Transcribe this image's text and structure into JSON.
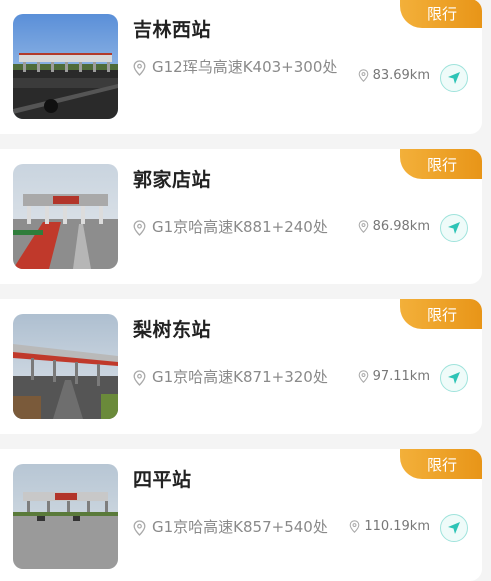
{
  "stations": [
    {
      "name": "吉林西站",
      "address": "G12珲乌高速K403+300处",
      "distance": "83.69km",
      "badge": "限行",
      "photo_icon": "toll-station-photo"
    },
    {
      "name": "郭家店站",
      "address": "G1京哈高速K881+240处",
      "distance": "86.98km",
      "badge": "限行",
      "photo_icon": "toll-station-photo"
    },
    {
      "name": "梨树东站",
      "address": "G1京哈高速K871+320处",
      "distance": "97.11km",
      "badge": "限行",
      "photo_icon": "toll-station-photo"
    },
    {
      "name": "四平站",
      "address": "G1京哈高速K857+540处",
      "distance": "110.19km",
      "badge": "限行",
      "photo_icon": "toll-station-photo"
    }
  ],
  "colors": {
    "badge_start": "#f3b03a",
    "badge_end": "#e89518",
    "nav_accent": "#2ec4b6",
    "background": "#f4f4f4"
  }
}
